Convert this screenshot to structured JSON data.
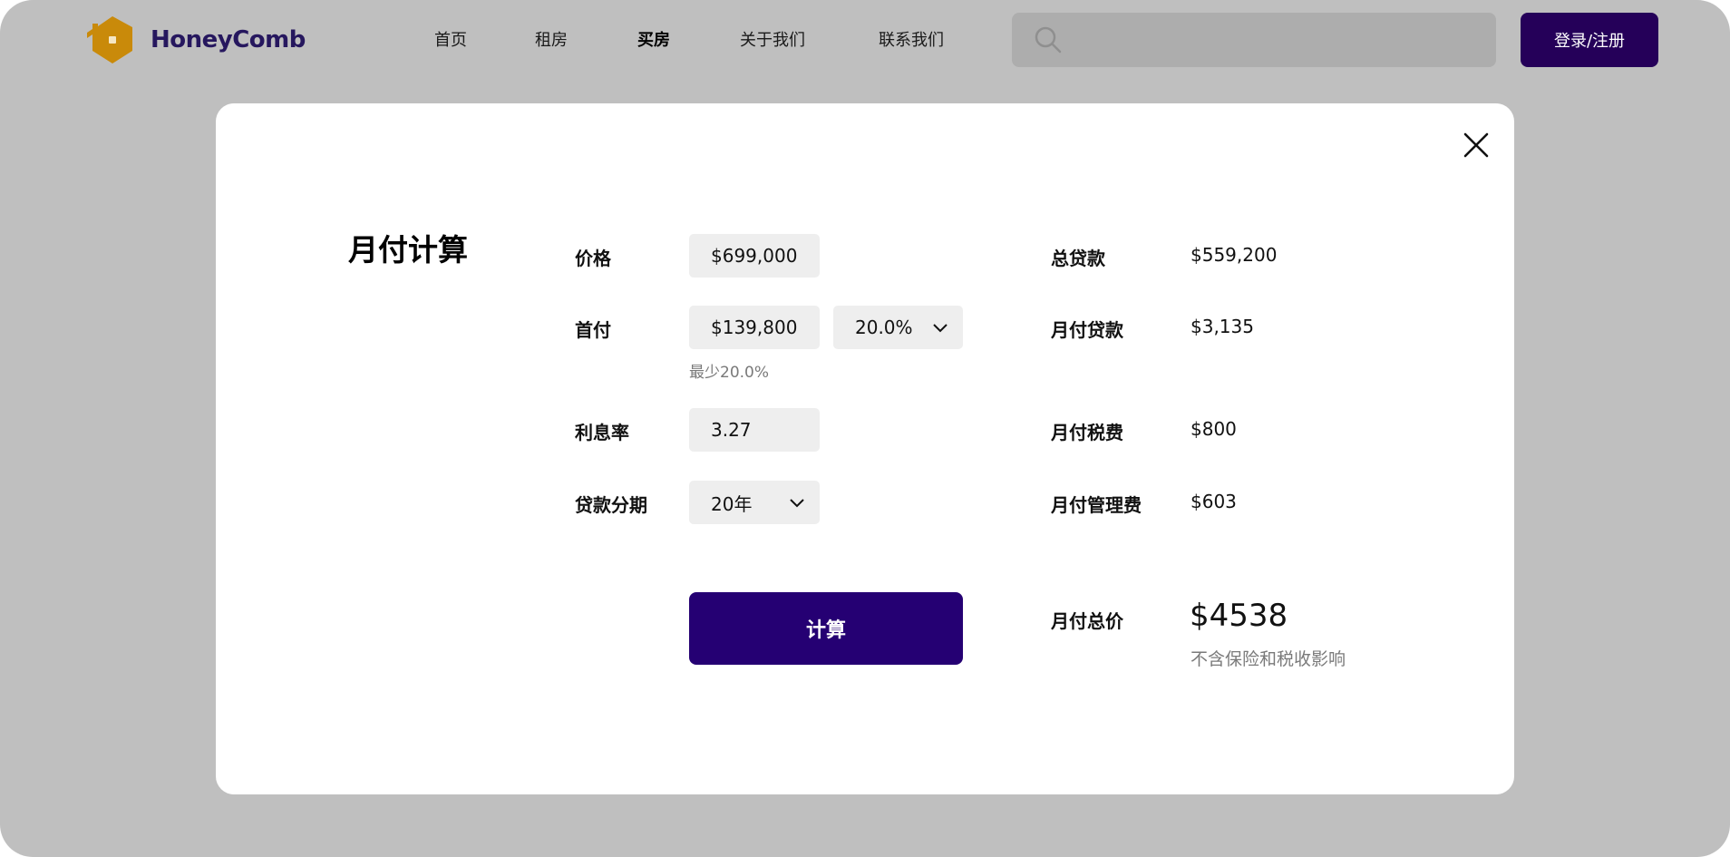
{
  "header": {
    "brand": "HoneyComb",
    "brand_color": "#26175e",
    "logo_color": "#c98a0a",
    "nav": [
      {
        "label": "首页",
        "active": false
      },
      {
        "label": "租房",
        "active": false
      },
      {
        "label": "买房",
        "active": true
      },
      {
        "label": "关于我们",
        "active": false
      },
      {
        "label": "联系我们",
        "active": false
      }
    ],
    "search": {
      "placeholder": "",
      "value": "",
      "icon": "search-icon"
    },
    "login_label": "登录/注册",
    "accent": "#250059"
  },
  "modal": {
    "title": "月付计算",
    "close_icon": "close-icon",
    "form": {
      "price": {
        "label": "价格",
        "value": "$699,000"
      },
      "down_payment": {
        "label": "首付",
        "value": "$139,800",
        "percent": "20.0%",
        "hint": "最少20.0%"
      },
      "interest": {
        "label": "利息率",
        "value": "3.27"
      },
      "term": {
        "label": "贷款分期",
        "value": "20年"
      },
      "calculate_label": "计算"
    },
    "results": {
      "total_loan": {
        "label": "总贷款",
        "value": "$559,200"
      },
      "monthly_loan": {
        "label": "月付贷款",
        "value": "$3,135"
      },
      "monthly_tax": {
        "label": "月付税费",
        "value": "$800"
      },
      "monthly_fee": {
        "label": "月付管理费",
        "value": "$603"
      },
      "monthly_total": {
        "label": "月付总价",
        "value": "$4538",
        "note": "不含保险和税收影响"
      }
    }
  }
}
